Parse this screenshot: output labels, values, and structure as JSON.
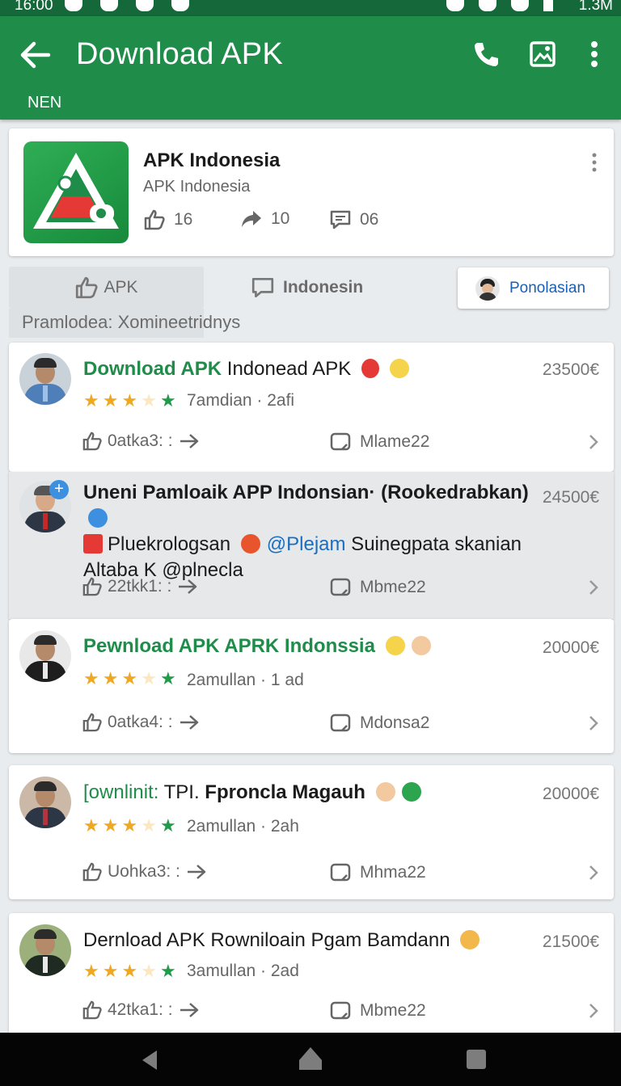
{
  "status_bar": {
    "time": "16:00",
    "network": "1.3M"
  },
  "app_bar": {
    "title": "Download APK",
    "subtitle": "NEN"
  },
  "app_card": {
    "name": "APK Indonesia",
    "developer": "APK Indonesia",
    "likes": "16",
    "shares": "10",
    "comments": "06"
  },
  "tabs": [
    {
      "label": "APK"
    },
    {
      "label": "Indonesin"
    },
    {
      "label": "Ponolasian"
    }
  ],
  "filter_text": "Pramlodea: Xomineetridnys",
  "reviews": [
    {
      "title_green": "Download APK",
      "title_rest": " Indonead APK",
      "price": "23500€",
      "meta": "7amdian · 2afi",
      "likes": "0atka3: :",
      "count": "Mlame22",
      "stars": 4
    },
    {
      "line1": "Uneni Pamloaik APP Indonsian· (Rookedrabkan)",
      "line2_a": "Pluekrologsan",
      "line2_b": "@Plejam",
      "line2_c": " Suinegpata skanian",
      "line3": "Altaba K  @plnecla",
      "price": "24500€",
      "likes": "22tkk1: :",
      "count": "Mbme22"
    },
    {
      "title_green": "Pewnload APK APRK Indonssia",
      "title_rest": "",
      "price": "20000€",
      "meta": "2amullan · 1 ad",
      "likes": "0atka4: :",
      "count": "Mdonsa2",
      "stars": 4
    },
    {
      "title_green": "[ownlinit:",
      "title_rest": " TPI. ",
      "title_bold": "Fproncla Magauh",
      "price": "20000€",
      "meta": "2amullan · 2ah",
      "likes": "Uohka3: :",
      "count": "Mhma22",
      "stars": 4
    },
    {
      "title_rest": "Dernload APK Rowniloain Pgam Bamdann",
      "price": "21500€",
      "meta": "3amullan · 2ad",
      "likes": "42tka1: :",
      "count": "Mbme22",
      "stars": 4
    }
  ],
  "colors": {
    "primary": "#1f8c4a",
    "statusbar": "#15683a",
    "star": "#f0a820",
    "star_green": "#1f9b4a",
    "link": "#1a6fc0"
  },
  "icons": [
    "back-arrow-icon",
    "phone-icon",
    "image-icon",
    "more-vert-icon",
    "thumbs-up-icon",
    "share-icon",
    "comment-icon",
    "chevron-right-icon",
    "star-icon"
  ]
}
